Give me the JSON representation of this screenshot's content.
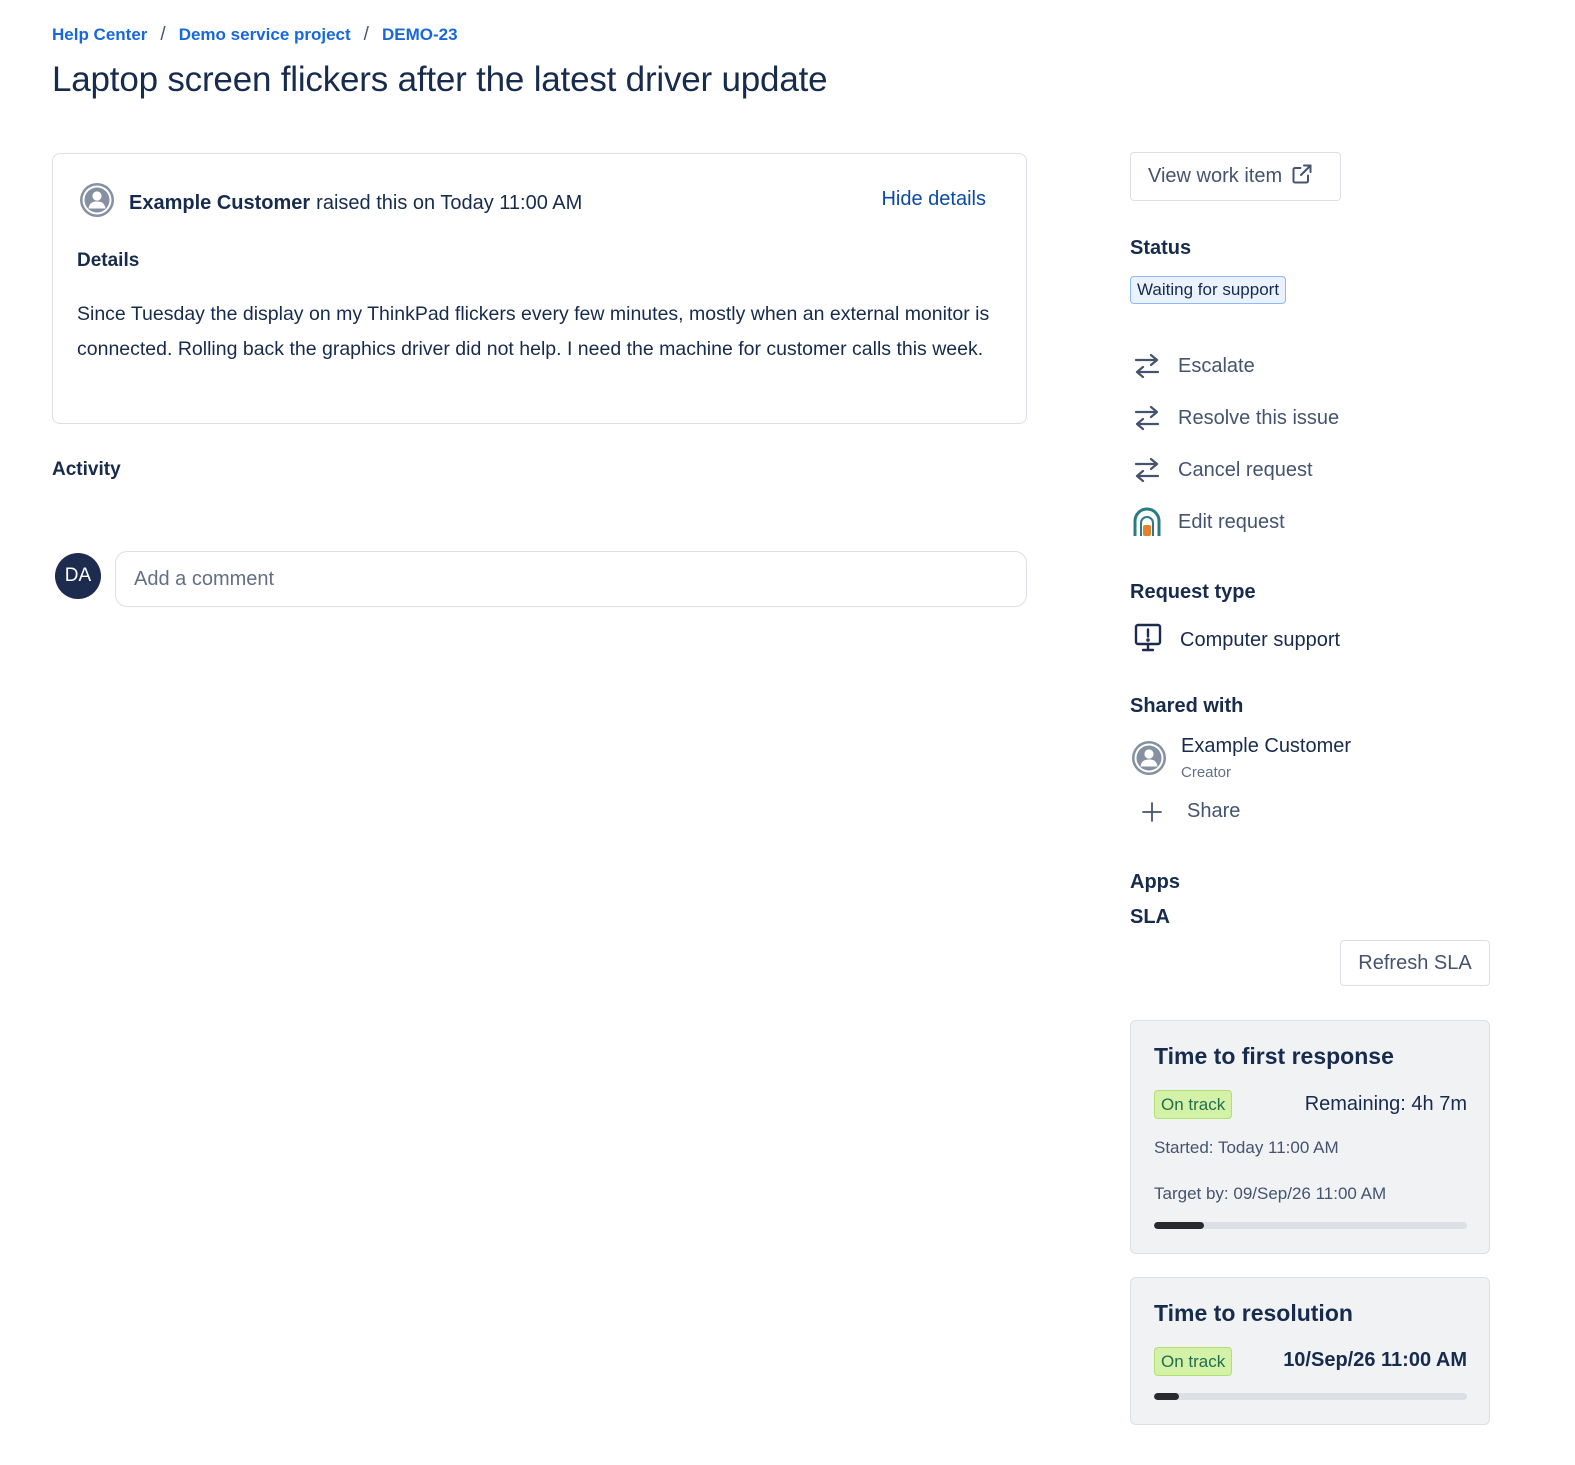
{
  "breadcrumb": {
    "items": [
      "Help Center",
      "Demo service project",
      "DEMO-23"
    ],
    "separator": "/"
  },
  "title": "Laptop screen flickers after the latest driver update",
  "details_card": {
    "raised_by": "Example Customer",
    "raised_text": "raised this on Today 11:00 AM",
    "hide_details": "Hide details",
    "heading": "Details",
    "body": "Since Tuesday the display on my ThinkPad flickers every few minutes, mostly when an external monitor is connected. Rolling back the graphics driver did not help. I need the machine for customer calls this week."
  },
  "activity": {
    "heading": "Activity",
    "avatar_initials": "DA",
    "comment_placeholder": "Add a comment"
  },
  "sidebar": {
    "view_work_item": "View work item",
    "status_label": "Status",
    "status_value": "Waiting for support",
    "actions": [
      {
        "label": "Escalate",
        "icon": "transition-icon"
      },
      {
        "label": "Resolve this issue",
        "icon": "transition-icon"
      },
      {
        "label": "Cancel request",
        "icon": "transition-icon"
      },
      {
        "label": "Edit request",
        "icon": "edit-request-icon"
      }
    ],
    "request_type_label": "Request type",
    "request_type": "Computer support",
    "shared_with_label": "Shared with",
    "shared_person": {
      "name": "Example Customer",
      "role": "Creator"
    },
    "share_label": "Share",
    "apps_label": "Apps",
    "sla_label": "SLA",
    "refresh_sla": "Refresh SLA",
    "sla_cards": [
      {
        "title": "Time to first response",
        "status": "On track",
        "remaining": "Remaining: 4h 7m",
        "started": "Started: Today 11:00 AM",
        "target": "Target by: 09/Sep/26 11:00 AM",
        "progress": 0.16
      },
      {
        "title": "Time to resolution",
        "status": "On track",
        "due": "10/Sep/26 11:00 AM",
        "progress": 0.08
      }
    ]
  },
  "colors": {
    "link": "#1868db",
    "text": "#172b4d",
    "status_bg": "#e9f2fe",
    "ontrack_bg": "#d3f1a7",
    "avatar_bg": "#1d2b4f"
  }
}
